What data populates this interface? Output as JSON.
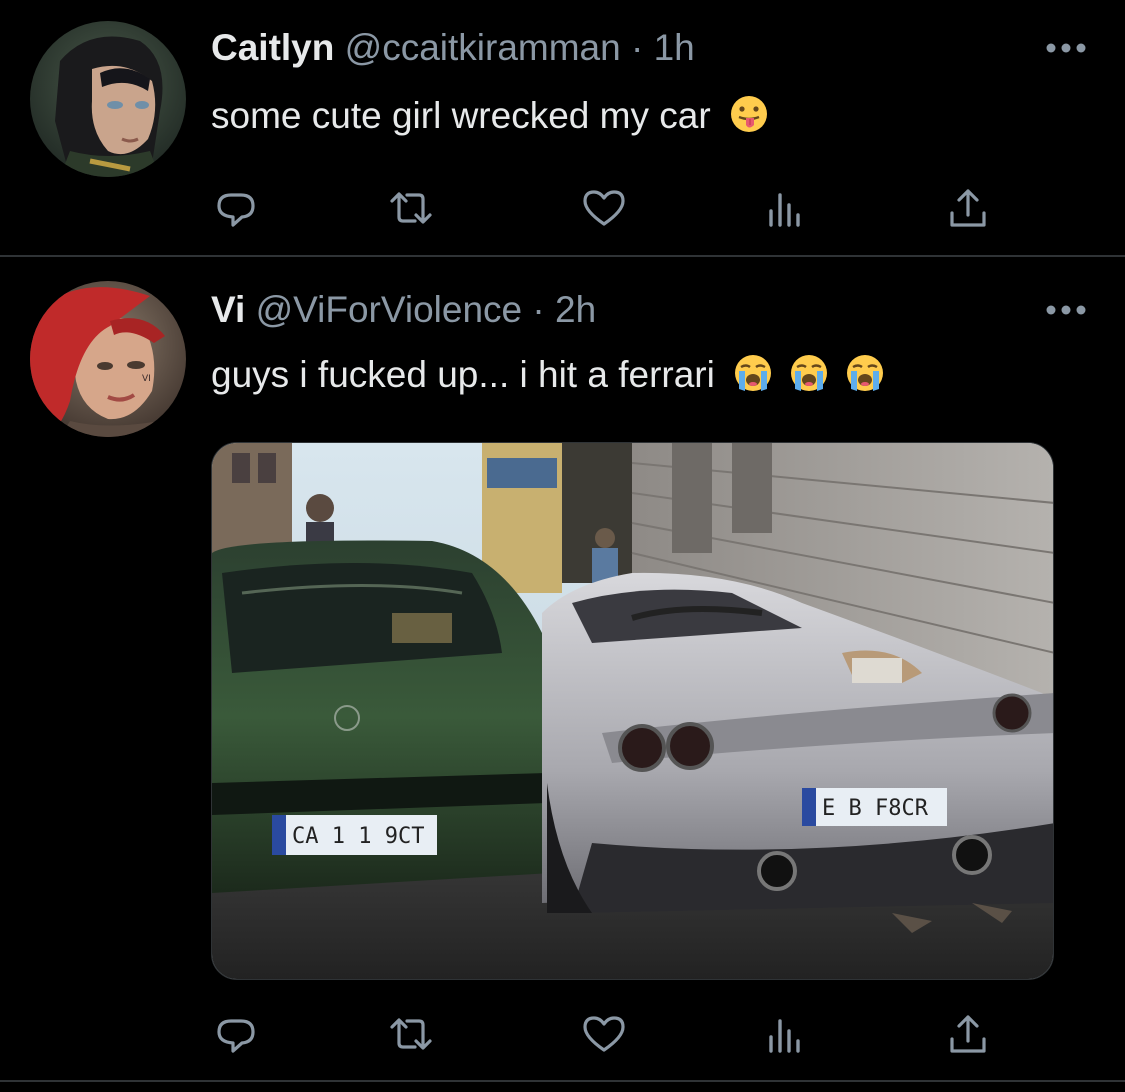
{
  "colors": {
    "background": "#000000",
    "primary_text": "#e7e9ea",
    "secondary_text": "#8b98a5",
    "divider": "#2f3336",
    "icon": "#8b98a5"
  },
  "tweets": [
    {
      "name": "Caitlyn",
      "handle": "@ccaitkiramman",
      "separator": "·",
      "time": "1h",
      "text": "some cute girl wrecked my car",
      "emojis": [
        "face-with-tongue-emoji"
      ],
      "has_media": false
    },
    {
      "name": "Vi",
      "handle": "@ViForViolence",
      "separator": "·",
      "time": "2h",
      "text": "guys i fucked up... i hit a ferrari",
      "emojis": [
        "loudly-crying-face-emoji",
        "loudly-crying-face-emoji",
        "loudly-crying-face-emoji"
      ],
      "has_media": true
    }
  ],
  "action_icons": [
    "reply-icon",
    "retweet-icon",
    "like-icon",
    "views-icon",
    "share-icon"
  ]
}
